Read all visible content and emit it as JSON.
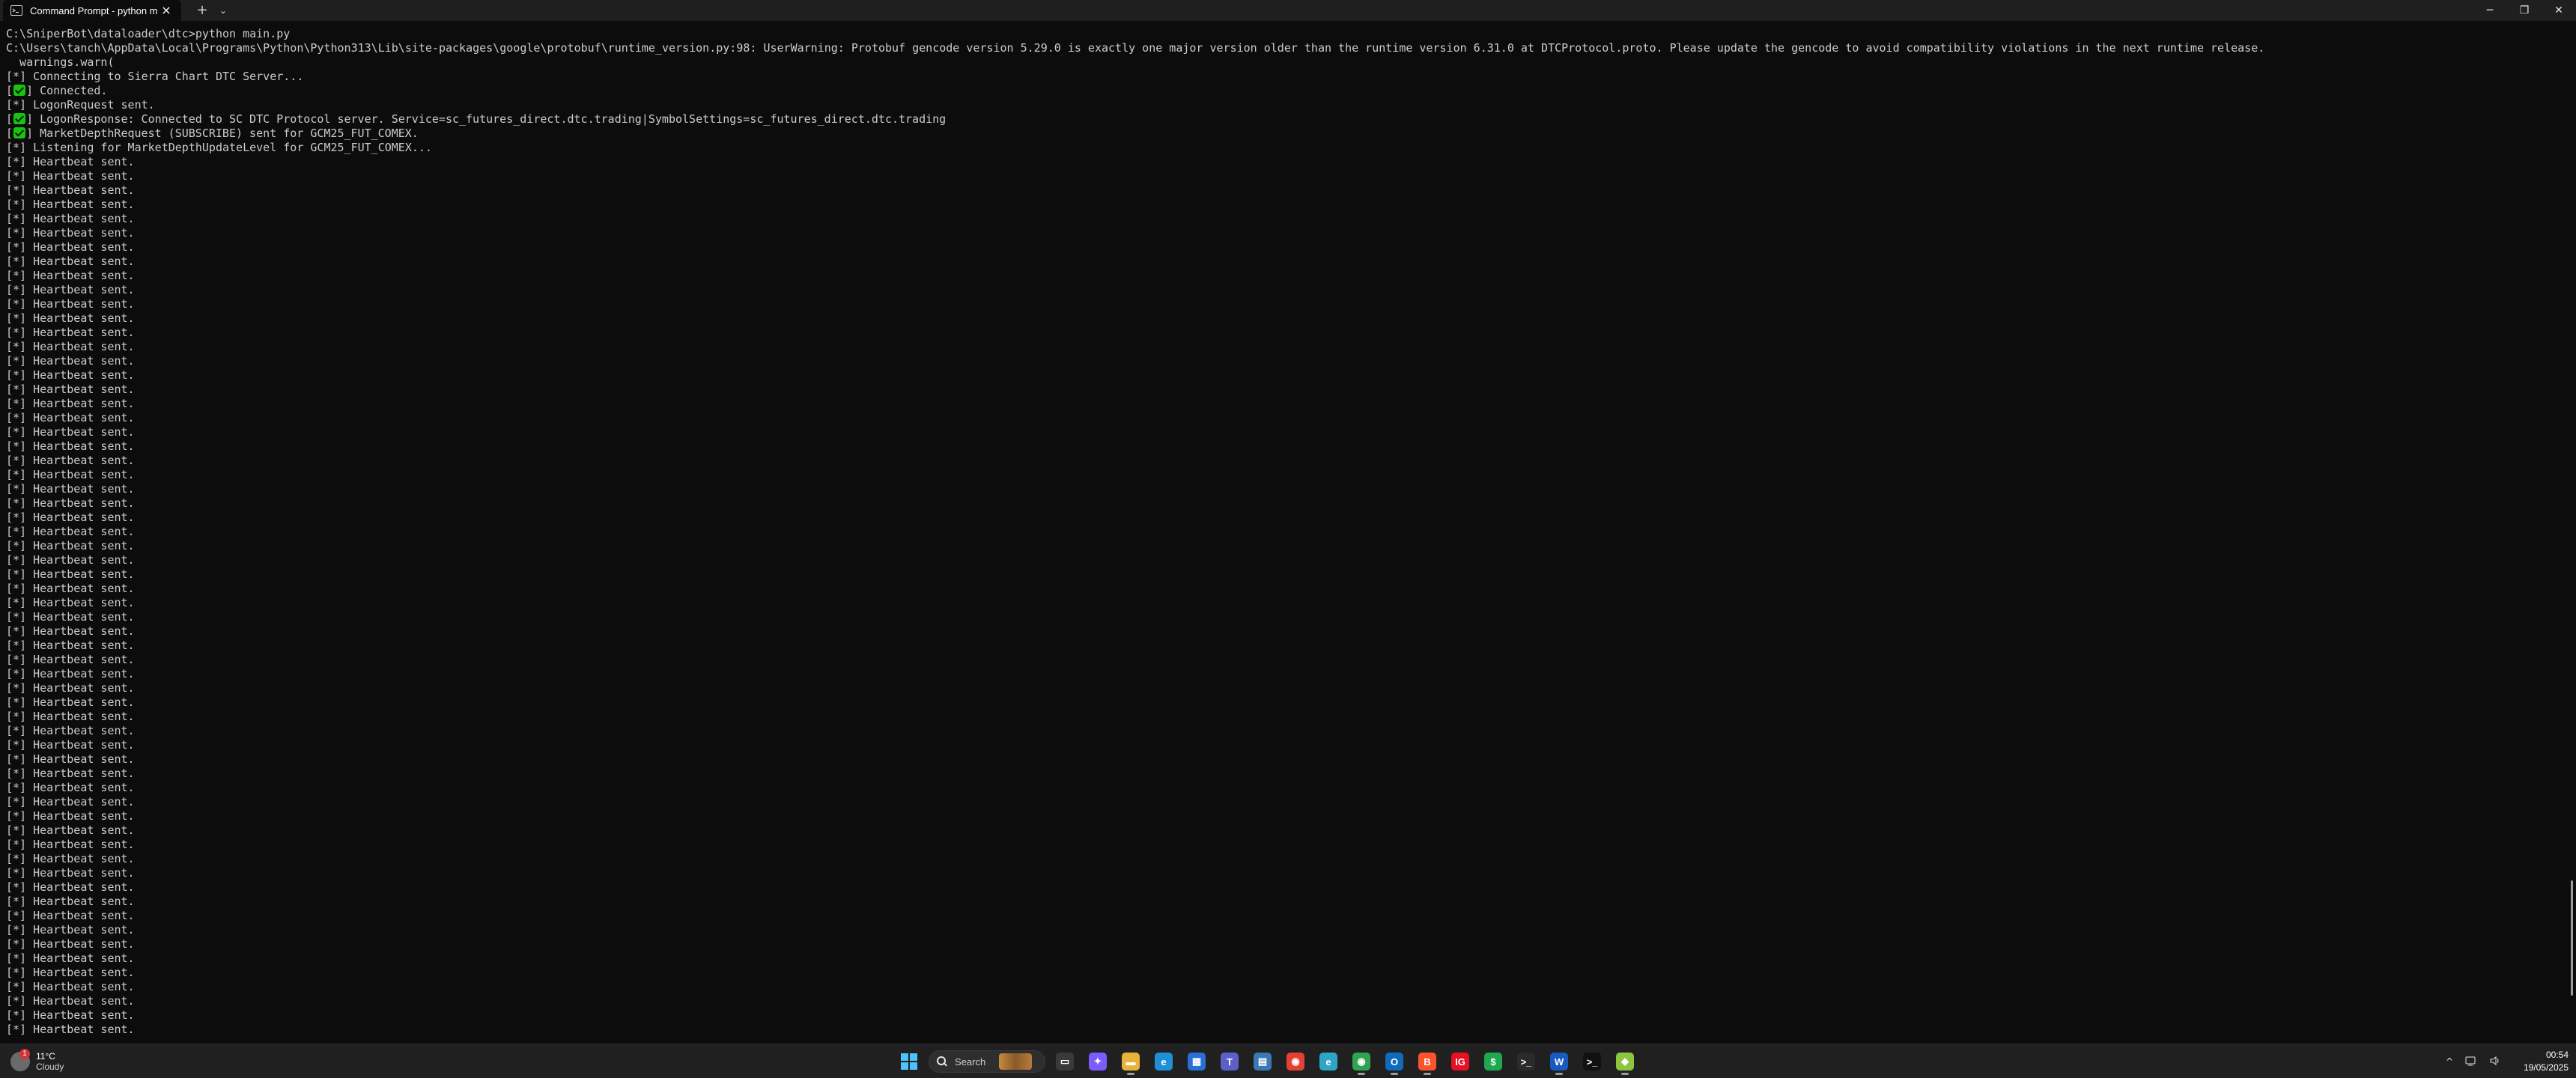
{
  "window": {
    "tab_title": "Command Prompt - python main.py",
    "new_tab_label": "+",
    "dropdown_label": "⌄",
    "close_tab_label": "×",
    "minimize_label": "─",
    "maximize_label": "❐",
    "close_label": "✕"
  },
  "terminal": {
    "lines": [
      {
        "text": "C:\\SniperBot\\dataloader\\dtc>python main.py"
      },
      {
        "text": "C:\\Users\\tanch\\AppData\\Local\\Programs\\Python\\Python313\\Lib\\site-packages\\google\\protobuf\\runtime_version.py:98: UserWarning: Protobuf gencode version 5.29.0 is exactly one major version older than the runtime version 6.31.0 at DTCProtocol.proto. Please update the gencode to avoid compatibility violations in the next runtime release."
      },
      {
        "text": "  warnings.warn("
      },
      {
        "tag": "[*]",
        "text": " Connecting to Sierra Chart DTC Server..."
      },
      {
        "tag": "[",
        "check": true,
        "tag_end": "]",
        "text": " Connected."
      },
      {
        "tag": "[*]",
        "text": " LogonRequest sent."
      },
      {
        "tag": "[",
        "check": true,
        "tag_end": "]",
        "text": " LogonResponse: Connected to SC DTC Protocol server. Service=sc_futures_direct.dtc.trading|SymbolSettings=sc_futures_direct.dtc.trading"
      },
      {
        "tag": "[",
        "check": true,
        "tag_end": "]",
        "text": " MarketDepthRequest (SUBSCRIBE) sent for GCM25_FUT_COMEX."
      },
      {
        "tag": "[*]",
        "text": " Listening for MarketDepthUpdateLevel for GCM25_FUT_COMEX..."
      },
      {
        "tag": "[*]",
        "text": " Heartbeat sent."
      },
      {
        "tag": "[*]",
        "text": " Heartbeat sent."
      },
      {
        "tag": "[*]",
        "text": " Heartbeat sent."
      },
      {
        "tag": "[*]",
        "text": " Heartbeat sent."
      },
      {
        "tag": "[*]",
        "text": " Heartbeat sent."
      },
      {
        "tag": "[*]",
        "text": " Heartbeat sent."
      },
      {
        "tag": "[*]",
        "text": " Heartbeat sent."
      },
      {
        "tag": "[*]",
        "text": " Heartbeat sent."
      },
      {
        "tag": "[*]",
        "text": " Heartbeat sent."
      },
      {
        "tag": "[*]",
        "text": " Heartbeat sent."
      },
      {
        "tag": "[*]",
        "text": " Heartbeat sent."
      },
      {
        "tag": "[*]",
        "text": " Heartbeat sent."
      },
      {
        "tag": "[*]",
        "text": " Heartbeat sent."
      },
      {
        "tag": "[*]",
        "text": " Heartbeat sent."
      },
      {
        "tag": "[*]",
        "text": " Heartbeat sent."
      },
      {
        "tag": "[*]",
        "text": " Heartbeat sent."
      },
      {
        "tag": "[*]",
        "text": " Heartbeat sent."
      },
      {
        "tag": "[*]",
        "text": " Heartbeat sent."
      },
      {
        "tag": "[*]",
        "text": " Heartbeat sent."
      },
      {
        "tag": "[*]",
        "text": " Heartbeat sent."
      },
      {
        "tag": "[*]",
        "text": " Heartbeat sent."
      },
      {
        "tag": "[*]",
        "text": " Heartbeat sent."
      },
      {
        "tag": "[*]",
        "text": " Heartbeat sent."
      },
      {
        "tag": "[*]",
        "text": " Heartbeat sent."
      },
      {
        "tag": "[*]",
        "text": " Heartbeat sent."
      },
      {
        "tag": "[*]",
        "text": " Heartbeat sent."
      },
      {
        "tag": "[*]",
        "text": " Heartbeat sent."
      },
      {
        "tag": "[*]",
        "text": " Heartbeat sent."
      },
      {
        "tag": "[*]",
        "text": " Heartbeat sent."
      },
      {
        "tag": "[*]",
        "text": " Heartbeat sent."
      },
      {
        "tag": "[*]",
        "text": " Heartbeat sent."
      },
      {
        "tag": "[*]",
        "text": " Heartbeat sent."
      },
      {
        "tag": "[*]",
        "text": " Heartbeat sent."
      },
      {
        "tag": "[*]",
        "text": " Heartbeat sent."
      },
      {
        "tag": "[*]",
        "text": " Heartbeat sent."
      },
      {
        "tag": "[*]",
        "text": " Heartbeat sent."
      },
      {
        "tag": "[*]",
        "text": " Heartbeat sent."
      },
      {
        "tag": "[*]",
        "text": " Heartbeat sent."
      },
      {
        "tag": "[*]",
        "text": " Heartbeat sent."
      },
      {
        "tag": "[*]",
        "text": " Heartbeat sent."
      },
      {
        "tag": "[*]",
        "text": " Heartbeat sent."
      },
      {
        "tag": "[*]",
        "text": " Heartbeat sent."
      },
      {
        "tag": "[*]",
        "text": " Heartbeat sent."
      },
      {
        "tag": "[*]",
        "text": " Heartbeat sent."
      },
      {
        "tag": "[*]",
        "text": " Heartbeat sent."
      },
      {
        "tag": "[*]",
        "text": " Heartbeat sent."
      },
      {
        "tag": "[*]",
        "text": " Heartbeat sent."
      },
      {
        "tag": "[*]",
        "text": " Heartbeat sent."
      },
      {
        "tag": "[*]",
        "text": " Heartbeat sent."
      },
      {
        "tag": "[*]",
        "text": " Heartbeat sent."
      },
      {
        "tag": "[*]",
        "text": " Heartbeat sent."
      },
      {
        "tag": "[*]",
        "text": " Heartbeat sent."
      },
      {
        "tag": "[*]",
        "text": " Heartbeat sent."
      },
      {
        "tag": "[*]",
        "text": " Heartbeat sent."
      },
      {
        "tag": "[*]",
        "text": " Heartbeat sent."
      },
      {
        "tag": "[*]",
        "text": " Heartbeat sent."
      },
      {
        "tag": "[*]",
        "text": " Heartbeat sent."
      },
      {
        "tag": "[*]",
        "text": " Heartbeat sent."
      },
      {
        "tag": "[*]",
        "text": " Heartbeat sent."
      },
      {
        "tag": "[*]",
        "text": " Heartbeat sent."
      },
      {
        "tag": "[*]",
        "text": " Heartbeat sent."
      },
      {
        "tag": "[*]",
        "text": " Heartbeat sent."
      }
    ]
  },
  "taskbar": {
    "weather_temp": "11°C",
    "weather_condition": "Cloudy",
    "weather_badge": "1",
    "search_label": "Search",
    "apps": [
      {
        "icon": "windows-start-icon",
        "glyph": "",
        "color": "#3a9bdc",
        "state": ""
      },
      {
        "icon": "search-box",
        "glyph": "",
        "color": "",
        "state": ""
      },
      {
        "icon": "task-view-icon",
        "glyph": "▭",
        "color": "#3a3a3a",
        "state": ""
      },
      {
        "icon": "copilot-icon",
        "glyph": "✦",
        "color": "#7a5cff",
        "state": ""
      },
      {
        "icon": "file-explorer-icon",
        "glyph": "▬",
        "color": "#e8b339",
        "state": "active"
      },
      {
        "icon": "edge-icon",
        "glyph": "e",
        "color": "#1f8fd6",
        "state": ""
      },
      {
        "icon": "store-icon",
        "glyph": "▦",
        "color": "#2a6fd6",
        "state": ""
      },
      {
        "icon": "teams-icon",
        "glyph": "T",
        "color": "#5b5fc7",
        "state": ""
      },
      {
        "icon": "calculator-icon",
        "glyph": "▤",
        "color": "#3a78b5",
        "state": ""
      },
      {
        "icon": "chrome-icon",
        "glyph": "◉",
        "color": "#e44134",
        "state": ""
      },
      {
        "icon": "edge-dev-icon",
        "glyph": "e",
        "color": "#2fa6c8",
        "state": ""
      },
      {
        "icon": "chrome-green-icon",
        "glyph": "◉",
        "color": "#2fa34f",
        "state": "active"
      },
      {
        "icon": "outlook-icon",
        "glyph": "O",
        "color": "#0f6cbd",
        "state": "active"
      },
      {
        "icon": "brave-icon",
        "glyph": "B",
        "color": "#fb542b",
        "state": "active"
      },
      {
        "icon": "ig-app-icon",
        "glyph": "IG",
        "color": "#e81123",
        "state": ""
      },
      {
        "icon": "green-app-icon",
        "glyph": "$",
        "color": "#1fa84f",
        "state": ""
      },
      {
        "icon": "terminal-app-icon",
        "glyph": ">_",
        "color": "#2b2b2b",
        "state": ""
      },
      {
        "icon": "word-icon",
        "glyph": "W",
        "color": "#185abd",
        "state": "active"
      },
      {
        "icon": "command-prompt-icon",
        "glyph": ">_",
        "color": "#111111",
        "state": "focused"
      },
      {
        "icon": "python-app-icon",
        "glyph": "◆",
        "color": "#8cc63f",
        "state": "active"
      }
    ],
    "tray_chevron": "^",
    "clock_time": "00:54",
    "clock_date": "19/05/2025"
  }
}
